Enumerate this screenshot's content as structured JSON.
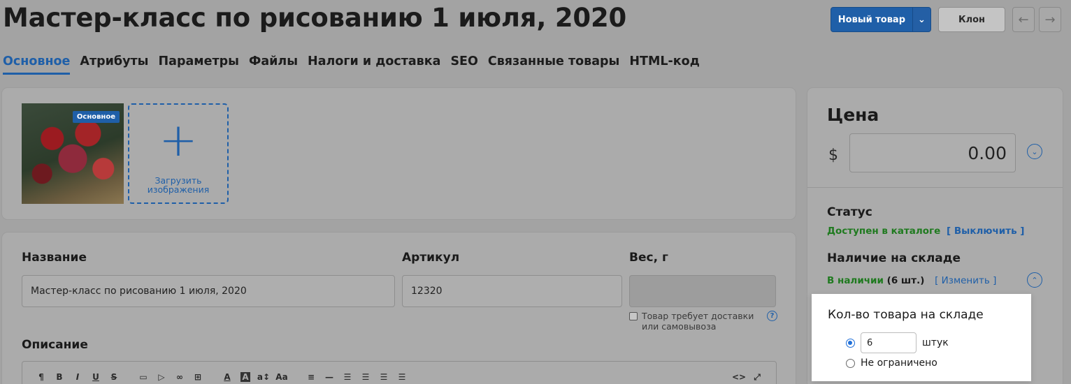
{
  "header": {
    "title": "Мастер-класс по рисованию 1 июля, 2020",
    "new_product_label": "Новый товар",
    "clone_label": "Клон",
    "prev_glyph": "←",
    "next_glyph": "→",
    "caret_glyph": "⌄"
  },
  "tabs": [
    {
      "label": "Основное",
      "active": true
    },
    {
      "label": "Атрибуты"
    },
    {
      "label": "Параметры"
    },
    {
      "label": "Файлы"
    },
    {
      "label": "Налоги и доставка"
    },
    {
      "label": "SEO"
    },
    {
      "label": "Связанные товары"
    },
    {
      "label": "HTML-код"
    }
  ],
  "images": {
    "main_badge": "Основное",
    "upload_plus": "+",
    "upload_label": "Загрузить изображения"
  },
  "form": {
    "name_label": "Название",
    "name_value": "Мастер-класс по рисованию 1 июля, 2020",
    "sku_label": "Артикул",
    "sku_value": "12320",
    "weight_label": "Вес, г",
    "weight_value": "",
    "shipping_checkbox_label": "Товар требует доставки или самовывоза",
    "help_glyph": "?",
    "description_label": "Описание"
  },
  "editor_toolbar": [
    "¶",
    "B",
    "I",
    "U",
    "S",
    "▭",
    "▷",
    "∞",
    "⊞",
    "A",
    "A",
    "a↕",
    "Aa",
    "≡",
    "—",
    "☰",
    "☰",
    "☰",
    "☰",
    "<>",
    "⤢"
  ],
  "price": {
    "title": "Цена",
    "currency": "$",
    "value": "0.00",
    "toggle_glyph": "⌄"
  },
  "status": {
    "title": "Статус",
    "state": "Доступен в каталоге",
    "action": "[ Выключить ]"
  },
  "stock": {
    "title": "Наличие на складе",
    "state": "В наличии",
    "count": "(6 шт.)",
    "action": "[ Изменить ]",
    "toggle_glyph": "⌃",
    "popup_title": "Кол-во товара на складе",
    "qty_value": "6",
    "qty_unit": "штук",
    "unlimited_label": "Не ограничено"
  },
  "colors": {
    "accent": "#1f5fa8",
    "success": "#1f7a1f"
  }
}
